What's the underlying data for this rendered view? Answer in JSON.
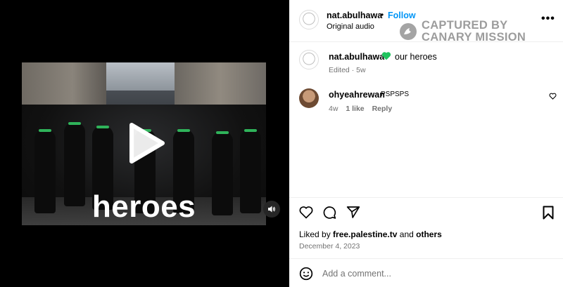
{
  "post": {
    "author": "nat.abulhawa",
    "separator": "•",
    "follow_label": "Follow",
    "audio": "Original audio",
    "more_label": "•••",
    "caption": "our heroes",
    "caption_emoji": "green-heart-icon",
    "edited": "Edited",
    "edited_age": "5w",
    "video_overlay_text": "heroes"
  },
  "watermark": {
    "line1": "CAPTURED BY",
    "line2": "CANARY MISSION"
  },
  "comment": {
    "author": "ohyeahrewan",
    "text": "PSPSPS",
    "age": "4w",
    "likes": "1 like",
    "reply_label": "Reply"
  },
  "likes": {
    "prefix": "Liked by",
    "user": "free.palestine.tv",
    "conj": "and",
    "others": "others"
  },
  "date": "December 4, 2023",
  "add_comment_placeholder": "Add a comment...",
  "colors": {
    "follow": "#0095f6",
    "green_heart": "#20c35e",
    "muted": "#737373"
  }
}
